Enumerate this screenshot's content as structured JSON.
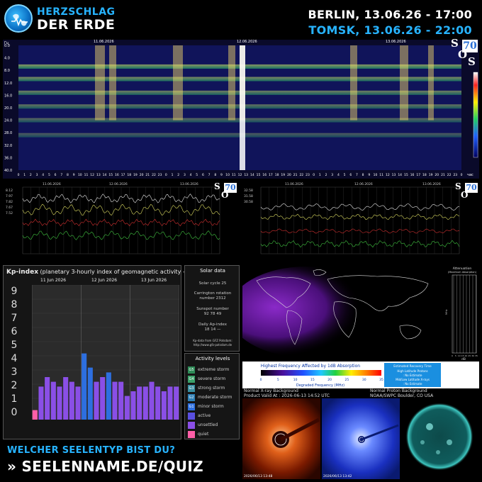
{
  "header": {
    "brand_line1": "HERZSCHLAG",
    "brand_line2": "DER ERDE",
    "city1": "BERLIN, 13.06.26 - 17:00",
    "city2": "TOMSK, 13.06.26 - 22:00"
  },
  "spectrogram": {
    "y_unit": "Гц",
    "y_ticks": [
      "0.0",
      "4.0",
      "8.0",
      "12.0",
      "16.0",
      "20.0",
      "24.0",
      "28.0",
      "32.0",
      "36.0",
      "40.0"
    ],
    "dates": [
      "11.06.2026",
      "12.06.2026",
      "13.06.2026"
    ],
    "hours_label": "час",
    "sos_text": "SOS",
    "sos_number": "70"
  },
  "graphs": {
    "left_dates": [
      "11.06.2026",
      "12.06.2026",
      "13.06.2026"
    ],
    "right_dates": [
      "11.06.2026",
      "12.06.2026",
      "13.06.2026"
    ],
    "left_y": [
      "8.12",
      "7.97",
      "7.82",
      "7.67",
      "7.52"
    ],
    "right_y": [
      "32.58",
      "31.58",
      "30.58"
    ]
  },
  "kp": {
    "title_bold": "Kp-index",
    "title_rest": "(planetary 3-hourly index of geomagnetic activity - provisional data)",
    "levels": [
      "9",
      "8",
      "7",
      "6",
      "5",
      "4",
      "3",
      "2",
      "1",
      "0"
    ],
    "days": [
      "11 Jun 2026",
      "12 Jun 2026",
      "13 Jun 2026"
    ],
    "bars": [
      {
        "v": 0.67,
        "c": "#ff5fa8"
      },
      {
        "v": 2.33,
        "c": "#8a4fe6"
      },
      {
        "v": 3.0,
        "c": "#8a4fe6"
      },
      {
        "v": 2.67,
        "c": "#8a4fe6"
      },
      {
        "v": 2.33,
        "c": "#8a4fe6"
      },
      {
        "v": 3.0,
        "c": "#8a4fe6"
      },
      {
        "v": 2.67,
        "c": "#8a4fe6"
      },
      {
        "v": 2.33,
        "c": "#8a4fe6"
      },
      {
        "v": 4.67,
        "c": "#2d6fe0"
      },
      {
        "v": 3.67,
        "c": "#2d6fe0"
      },
      {
        "v": 2.67,
        "c": "#8a4fe6"
      },
      {
        "v": 3.0,
        "c": "#8a4fe6"
      },
      {
        "v": 3.33,
        "c": "#2d6fe0"
      },
      {
        "v": 2.67,
        "c": "#8a4fe6"
      },
      {
        "v": 2.67,
        "c": "#8a4fe6"
      },
      {
        "v": 1.67,
        "c": "#8a4fe6"
      },
      {
        "v": 2.0,
        "c": "#8a4fe6"
      },
      {
        "v": 2.33,
        "c": "#8a4fe6"
      },
      {
        "v": 2.33,
        "c": "#8a4fe6"
      },
      {
        "v": 2.67,
        "c": "#8a4fe6"
      },
      {
        "v": 2.33,
        "c": "#8a4fe6"
      },
      {
        "v": 2.0,
        "c": "#8a4fe6"
      },
      {
        "v": 2.33,
        "c": "#8a4fe6"
      },
      {
        "v": 2.33,
        "c": "#8a4fe6"
      }
    ]
  },
  "solar": {
    "title": "Solar data",
    "cycle": "Solar cycle 25",
    "carrington_label": "Carrington rotation",
    "carrington_value": "number 2312",
    "sunspot_label": "Sunspot number",
    "sunspot_values": "92    78    49",
    "ap_label": "Daily Ap-index",
    "ap_values": "18    14    —",
    "source1": "Kp-data from GFZ Potsdam:",
    "source2": "http://www.gfz-potsdam.de"
  },
  "activity": {
    "title": "Activity levels",
    "items": [
      {
        "code": "G5",
        "label": "extreme storm",
        "color": "#2e8b57"
      },
      {
        "code": "G4",
        "label": "severe storm",
        "color": "#3aa068"
      },
      {
        "code": "G3",
        "label": "strong storm",
        "color": "#3a8fa0"
      },
      {
        "code": "G2",
        "label": "moderate storm",
        "color": "#2d7fb5"
      },
      {
        "code": "G1",
        "label": "minor storm",
        "color": "#2d6fe0"
      },
      {
        "code": "",
        "label": "active",
        "color": "#5a4fe0"
      },
      {
        "code": "",
        "label": "unsettled",
        "color": "#8a4fe6"
      },
      {
        "code": "",
        "label": "quiet",
        "color": "#ff5fa8"
      }
    ]
  },
  "absorption": {
    "legend_title": "Highest Frequency Affected by 1dB Absorption",
    "axis_label": "Degraded Frequency (MHz)",
    "scale": [
      "0",
      "5",
      "10",
      "15",
      "20",
      "25",
      "30",
      "35"
    ],
    "recovery_title": "Estimated Recovery Time",
    "recovery_lines": [
      "High Latitude Protons",
      ": No Estimate",
      "Mid/Low Latitude X-rays",
      ": No Estimate"
    ],
    "side_title1": "Attenuation",
    "side_title2": "(Maximum Absorption)",
    "side_unit": "dB",
    "side_x": [
      "0",
      "5",
      "10",
      "15",
      "20",
      "25",
      "30",
      "35"
    ],
    "side_ylabel": "MHz"
  },
  "sun": {
    "label1a": "Normal X-ray Background",
    "label1b": "Product Valid At : 2026-06-13 14:52 UTC",
    "label2a": "Normal Proton Background",
    "label2b": "NOAA/SWPC Boulder, CO USA",
    "img1_time": "2026/06/13 13:48",
    "img2_time": "2026/06/13 13:42"
  },
  "promo": {
    "line1": "WELCHER SEELENTYP BIST DU?",
    "line2": "» SEELENNAME.DE/QUIZ"
  }
}
